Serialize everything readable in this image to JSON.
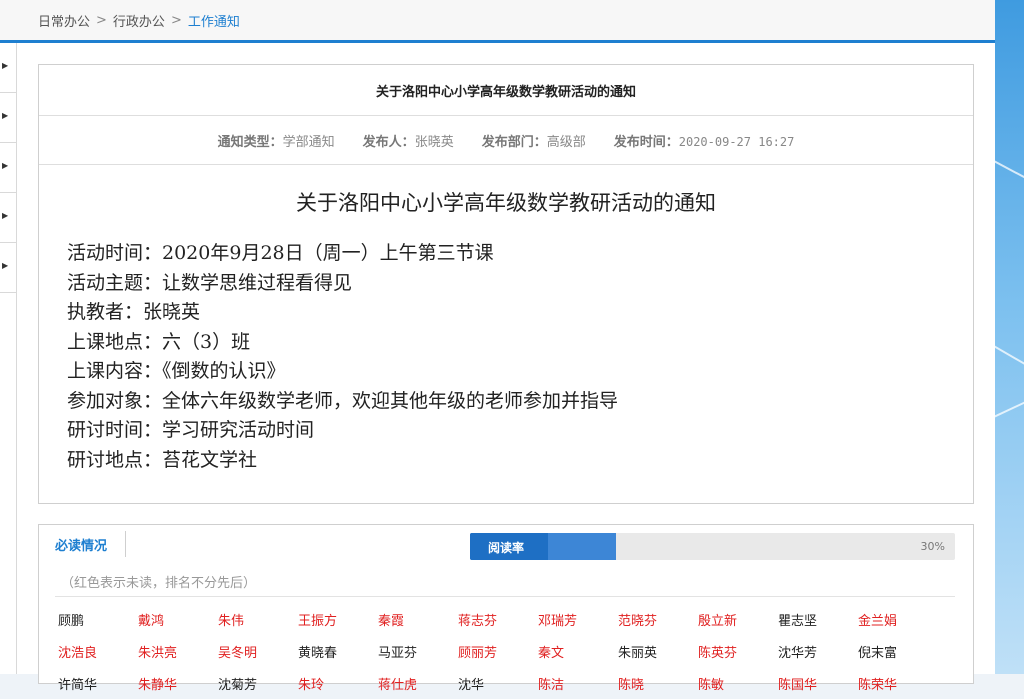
{
  "breadcrumb": {
    "items": [
      "日常办公",
      "行政办公"
    ],
    "current": "工作通知",
    "separator": ">"
  },
  "notice": {
    "header_title": "关于洛阳中心小学高年级数学教研活动的通知",
    "meta": {
      "type_label": "通知类型：",
      "type_value": "学部通知",
      "publisher_label": "发布人：",
      "publisher_value": "张晓英",
      "dept_label": "发布部门：",
      "dept_value": "高级部",
      "time_label": "发布时间：",
      "time_value": "2020-09-27 16:27"
    },
    "doc_title": "关于洛阳中心小学高年级数学教研活动的通知",
    "lines": [
      "活动时间：2020年9月28日（周一）上午第三节课",
      "活动主题：让数学思维过程看得见",
      "执教者：张晓英",
      "上课地点：六（3）班",
      "上课内容：《倒数的认识》",
      "参加对象：全体六年级数学老师，欢迎其他年级的老师参加并指导",
      "研讨时间：学习研究活动时间",
      "研讨地点：苔花文学社"
    ]
  },
  "reading": {
    "tab_label": "必读情况",
    "progress_label": "阅读率",
    "progress_percent_text": "30%",
    "progress_value": 0.3,
    "note": "（红色表示未读，排名不分先后）",
    "colors": {
      "read": "#222222",
      "unread": "#e02020",
      "accent": "#1e7fd0"
    },
    "rows": [
      [
        {
          "name": "顾鹏",
          "read": true
        },
        {
          "name": "戴鸿",
          "read": false
        },
        {
          "name": "朱伟",
          "read": false
        },
        {
          "name": "王振方",
          "read": false
        },
        {
          "name": "秦霞",
          "read": false
        },
        {
          "name": "蒋志芬",
          "read": false
        },
        {
          "name": "邓瑞芳",
          "read": false
        },
        {
          "name": "范晓芬",
          "read": false
        },
        {
          "name": "殷立新",
          "read": false
        },
        {
          "name": "瞿志坚",
          "read": true
        },
        {
          "name": "金兰娟",
          "read": false
        }
      ],
      [
        {
          "name": "沈浩良",
          "read": false
        },
        {
          "name": "朱洪亮",
          "read": false
        },
        {
          "name": "吴冬明",
          "read": false
        },
        {
          "name": "黄晓春",
          "read": true
        },
        {
          "name": "马亚芬",
          "read": true
        },
        {
          "name": "顾丽芳",
          "read": false
        },
        {
          "name": "秦文",
          "read": false
        },
        {
          "name": "朱丽英",
          "read": true
        },
        {
          "name": "陈英芬",
          "read": false
        },
        {
          "name": "沈华芳",
          "read": true
        },
        {
          "name": "倪末富",
          "read": true
        }
      ],
      [
        {
          "name": "许简华",
          "read": true
        },
        {
          "name": "朱静华",
          "read": false
        },
        {
          "name": "沈菊芳",
          "read": true
        },
        {
          "name": "朱玲",
          "read": false
        },
        {
          "name": "蒋仕虎",
          "read": false
        },
        {
          "name": "沈华",
          "read": true
        },
        {
          "name": "陈洁",
          "read": false
        },
        {
          "name": "陈晓",
          "read": false
        },
        {
          "name": "陈敏",
          "read": false
        },
        {
          "name": "陈国华",
          "read": false
        },
        {
          "name": "陈荣华",
          "read": false
        }
      ]
    ]
  }
}
